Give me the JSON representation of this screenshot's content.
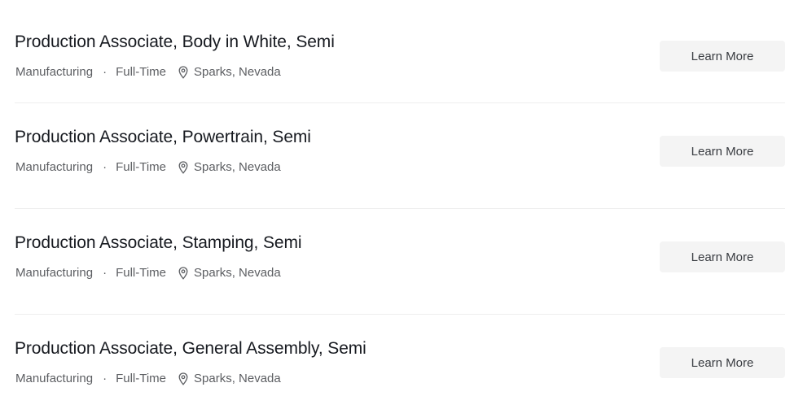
{
  "jobs": [
    {
      "title": "Production Associate, Body in White, Semi",
      "department": "Manufacturing",
      "separator": "·",
      "type": "Full-Time",
      "location": "Sparks, Nevada",
      "button_label": "Learn More",
      "location_icon": "map-pin-icon"
    },
    {
      "title": "Production Associate, Powertrain, Semi",
      "department": "Manufacturing",
      "separator": "·",
      "type": "Full-Time",
      "location": "Sparks, Nevada",
      "button_label": "Learn More",
      "location_icon": "map-pin-icon"
    },
    {
      "title": "Production Associate, Stamping, Semi",
      "department": "Manufacturing",
      "separator": "·",
      "type": "Full-Time",
      "location": "Sparks, Nevada",
      "button_label": "Learn More",
      "location_icon": "map-pin-icon"
    },
    {
      "title": "Production Associate, General Assembly, Semi",
      "department": "Manufacturing",
      "separator": "·",
      "type": "Full-Time",
      "location": "Sparks, Nevada",
      "button_label": "Learn More",
      "location_icon": "map-pin-icon"
    }
  ],
  "colors": {
    "title": "#171a20",
    "meta": "#5c5e62",
    "button_bg": "#f4f4f4",
    "divider": "#eeeeee"
  }
}
